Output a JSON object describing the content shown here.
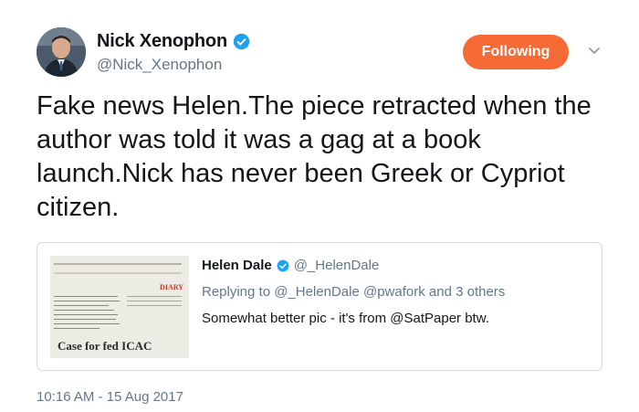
{
  "author": {
    "name": "Nick Xenophon",
    "handle": "@Nick_Xenophon",
    "verified": true,
    "avatar_icon": "profile-photo"
  },
  "follow_button": {
    "label": "Following",
    "color": "#f56a35"
  },
  "menu_icon": "chevron-down-icon",
  "tweet": {
    "text": "Fake news Helen.The piece retracted when the author was told it was a gag at a book launch.Nick has never been Greek or Cypriot citizen."
  },
  "quoted_tweet": {
    "author_name": "Helen Dale",
    "handle": "@_HelenDale",
    "verified": true,
    "replying_to": "Replying to @_HelenDale @pwafork and 3 others",
    "text": "Somewhat better pic - it's from @SatPaper btw.",
    "image": {
      "label": "DIARY",
      "caption": "Case for fed ICAC"
    }
  },
  "timestamp": "10:16 AM - 15 Aug 2017",
  "colors": {
    "accent": "#f56a35",
    "verified_blue": "#1da1f2",
    "secondary_text": "#657786"
  }
}
